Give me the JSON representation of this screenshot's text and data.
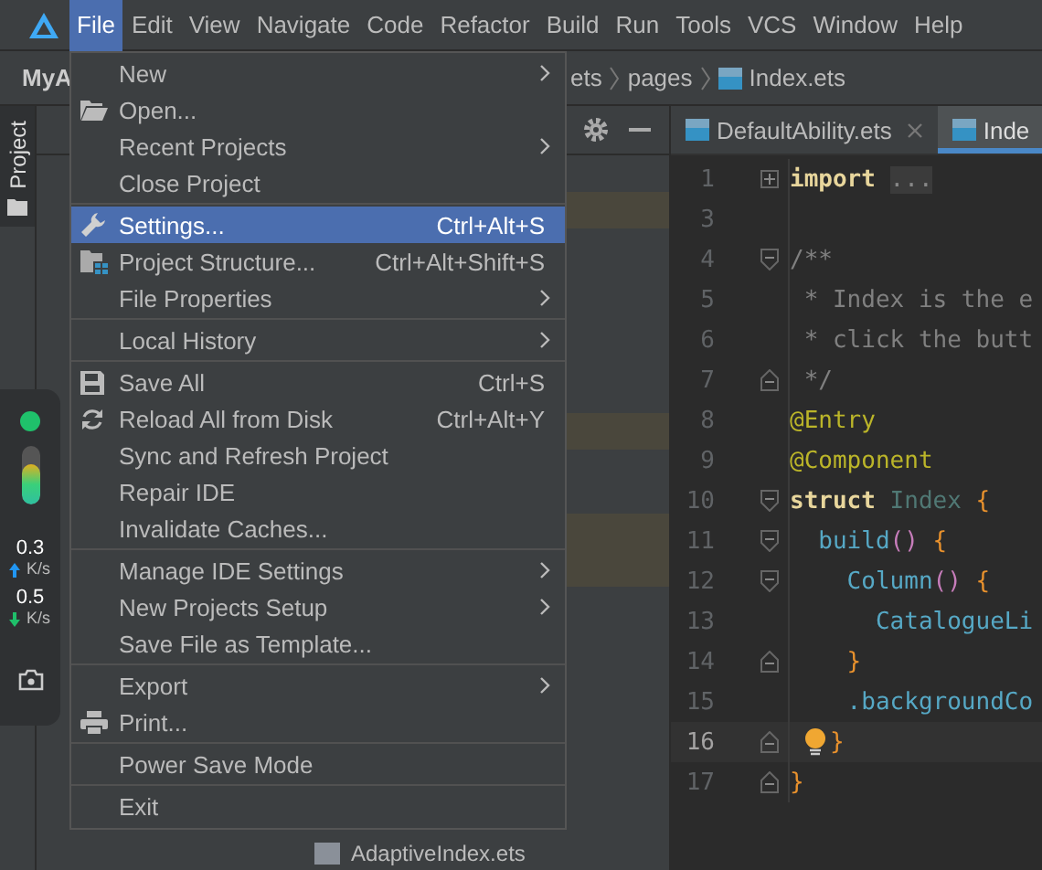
{
  "menubar": {
    "items": [
      {
        "label": "File",
        "selected": true
      },
      {
        "label": "Edit",
        "selected": false
      },
      {
        "label": "View",
        "selected": false
      },
      {
        "label": "Navigate",
        "selected": false
      },
      {
        "label": "Code",
        "selected": false
      },
      {
        "label": "Refactor",
        "selected": false
      },
      {
        "label": "Build",
        "selected": false
      },
      {
        "label": "Run",
        "selected": false
      },
      {
        "label": "Tools",
        "selected": false
      },
      {
        "label": "VCS",
        "selected": false
      },
      {
        "label": "Window",
        "selected": false
      },
      {
        "label": "Help",
        "selected": false
      }
    ]
  },
  "navbar": {
    "project": "MyA",
    "breadcrumb": [
      "ets",
      "pages",
      "Index.ets"
    ]
  },
  "tool_stripe": {
    "tab": "Project",
    "selected": true
  },
  "project_panel": {
    "bottom_file": "AdaptiveIndex.ets"
  },
  "monitor_widget": {
    "level": 0.7,
    "upload": "0.3",
    "upload_unit": "K/s",
    "download": "0.5",
    "download_unit": "K/s"
  },
  "editor": {
    "tabs": [
      {
        "label": "DefaultAbility.ets",
        "selected": false,
        "closable": true
      },
      {
        "label": "Inde",
        "selected": true,
        "closable": false
      }
    ],
    "lines": [
      {
        "num": "1",
        "kind": "fold-plus",
        "current": false,
        "bulb": false,
        "tokens": [
          {
            "kind": "keyword",
            "text": "import "
          },
          {
            "kind": "folded",
            "text": "..."
          }
        ]
      },
      {
        "num": "3",
        "kind": "plain",
        "current": false,
        "bulb": false
      },
      {
        "num": "4",
        "kind": "fold-start",
        "current": false,
        "bulb": false,
        "tokens": [
          {
            "kind": "comment",
            "text": "/**"
          }
        ]
      },
      {
        "num": "5",
        "kind": "plain",
        "current": false,
        "bulb": false,
        "tokens": [
          {
            "kind": "comment",
            "text": " * Index is the e"
          }
        ]
      },
      {
        "num": "6",
        "kind": "plain",
        "current": false,
        "bulb": false,
        "tokens": [
          {
            "kind": "comment",
            "text": " * click the butt"
          }
        ]
      },
      {
        "num": "7",
        "kind": "fold-end",
        "current": false,
        "bulb": false,
        "tokens": [
          {
            "kind": "comment",
            "text": " */"
          }
        ]
      },
      {
        "num": "8",
        "kind": "plain",
        "current": false,
        "bulb": false,
        "tokens": [
          {
            "kind": "annotation",
            "text": "@Entry"
          }
        ]
      },
      {
        "num": "9",
        "kind": "plain",
        "current": false,
        "bulb": false,
        "tokens": [
          {
            "kind": "annotation",
            "text": "@Component"
          }
        ]
      },
      {
        "num": "10",
        "kind": "fold-start",
        "current": false,
        "bulb": false,
        "tokens": [
          {
            "kind": "keyword",
            "text": "struct "
          },
          {
            "kind": "type",
            "text": "Index "
          },
          {
            "kind": "brace",
            "text": "{"
          }
        ]
      },
      {
        "num": "11",
        "kind": "fold-start",
        "current": false,
        "bulb": false,
        "tokens": [
          {
            "kind": "func",
            "text": "  build"
          },
          {
            "kind": "paren",
            "text": "() "
          },
          {
            "kind": "brace",
            "text": "{"
          }
        ]
      },
      {
        "num": "12",
        "kind": "fold-start",
        "current": false,
        "bulb": false,
        "tokens": [
          {
            "kind": "func",
            "text": "    Column"
          },
          {
            "kind": "paren",
            "text": "() "
          },
          {
            "kind": "brace",
            "text": "{"
          }
        ]
      },
      {
        "num": "13",
        "kind": "plain",
        "current": false,
        "bulb": false,
        "tokens": [
          {
            "kind": "func",
            "text": "      CatalogueLi"
          }
        ]
      },
      {
        "num": "14",
        "kind": "fold-end",
        "current": false,
        "bulb": false,
        "tokens": [
          {
            "kind": "brace",
            "text": "    }"
          }
        ]
      },
      {
        "num": "15",
        "kind": "plain",
        "current": false,
        "bulb": false,
        "tokens": [
          {
            "kind": "func",
            "text": "    .backgroundCo"
          }
        ]
      },
      {
        "num": "16",
        "kind": "fold-end",
        "current": true,
        "bulb": true,
        "tokens": [
          {
            "kind": "brace",
            "text": "}"
          }
        ]
      },
      {
        "num": "17",
        "kind": "fold-end",
        "current": false,
        "bulb": false,
        "tokens": [
          {
            "kind": "brace",
            "text": "}"
          }
        ]
      }
    ]
  },
  "file_menu": {
    "groups": [
      [
        {
          "label": "New",
          "kind": "plain",
          "submenu": true,
          "selected": false
        },
        {
          "label": "Open...",
          "kind": "folder",
          "submenu": false,
          "selected": false
        },
        {
          "label": "Recent Projects",
          "kind": "plain",
          "submenu": true,
          "selected": false
        },
        {
          "label": "Close Project",
          "kind": "plain",
          "submenu": false,
          "selected": false
        }
      ],
      [
        {
          "label": "Settings...",
          "kind": "wrench",
          "shortcut": "Ctrl+Alt+S",
          "submenu": false,
          "selected": true
        },
        {
          "label": "Project Structure...",
          "kind": "structure",
          "shortcut": "Ctrl+Alt+Shift+S",
          "submenu": false,
          "selected": false
        },
        {
          "label": "File Properties",
          "kind": "plain",
          "submenu": true,
          "selected": false
        }
      ],
      [
        {
          "label": "Local History",
          "kind": "plain",
          "submenu": true,
          "selected": false
        }
      ],
      [
        {
          "label": "Save All",
          "kind": "save",
          "shortcut": "Ctrl+S",
          "submenu": false,
          "selected": false
        },
        {
          "label": "Reload All from Disk",
          "kind": "reload",
          "shortcut": "Ctrl+Alt+Y",
          "submenu": false,
          "selected": false
        },
        {
          "label": "Sync and Refresh Project",
          "kind": "plain",
          "submenu": false,
          "selected": false
        },
        {
          "label": "Repair IDE",
          "kind": "plain",
          "submenu": false,
          "selected": false
        },
        {
          "label": "Invalidate Caches...",
          "kind": "plain",
          "submenu": false,
          "selected": false
        }
      ],
      [
        {
          "label": "Manage IDE Settings",
          "kind": "plain",
          "submenu": true,
          "selected": false
        },
        {
          "label": "New Projects Setup",
          "kind": "plain",
          "submenu": true,
          "selected": false
        },
        {
          "label": "Save File as Template...",
          "kind": "plain",
          "submenu": false,
          "selected": false
        }
      ],
      [
        {
          "label": "Export",
          "kind": "plain",
          "submenu": true,
          "selected": false
        },
        {
          "label": "Print...",
          "kind": "printer",
          "submenu": false,
          "selected": false
        }
      ],
      [
        {
          "label": "Power Save Mode",
          "kind": "plain",
          "submenu": false,
          "selected": false
        }
      ],
      [
        {
          "label": "Exit",
          "kind": "plain",
          "submenu": false,
          "selected": false
        }
      ]
    ]
  }
}
